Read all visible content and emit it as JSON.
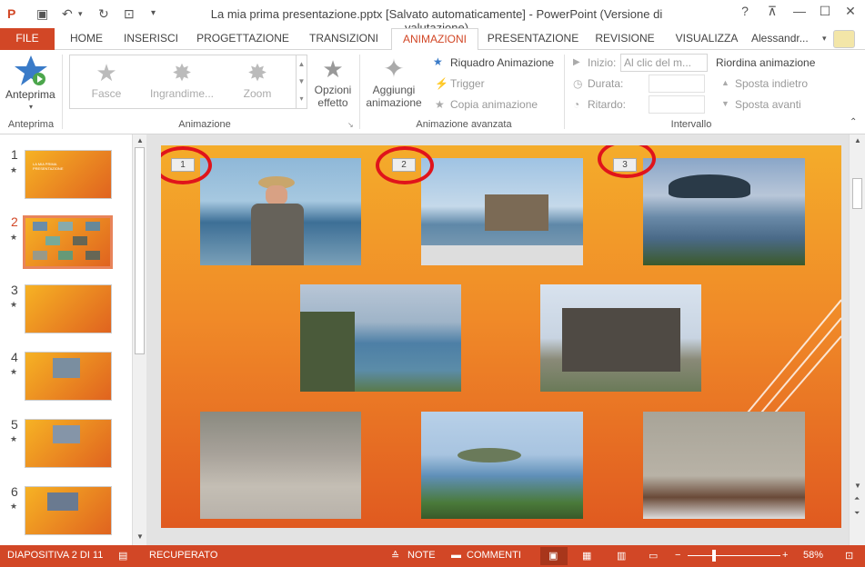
{
  "window": {
    "title": "La mia prima presentazione.pptx [Salvato automaticamente] - PowerPoint (Versione di valutazione)",
    "help": "?",
    "user": "Alessandr..."
  },
  "tabs": [
    "FILE",
    "HOME",
    "INSERISCI",
    "PROGETTAZIONE",
    "TRANSIZIONI",
    "ANIMAZIONI",
    "PRESENTAZIONE",
    "REVISIONE",
    "VISUALIZZA"
  ],
  "active_tab": "ANIMAZIONI",
  "ribbon": {
    "preview": {
      "label": "Anteprima",
      "group": "Anteprima"
    },
    "animation_group": {
      "label": "Animazione",
      "effects": [
        "Fasce",
        "Ingrandime...",
        "Zoom"
      ],
      "options": [
        "Opzioni",
        "effetto"
      ]
    },
    "advanced": {
      "label": "Animazione avanzata",
      "add": [
        "Aggiungi",
        "animazione"
      ],
      "pane": "Riquadro Animazione",
      "trigger": "Trigger",
      "copy": "Copia animazione"
    },
    "timing": {
      "label": "Intervallo",
      "start_label": "Inizio:",
      "start_value": "Al clic del m...",
      "duration_label": "Durata:",
      "delay_label": "Ritardo:",
      "reorder": "Riordina animazione",
      "move_back": "Sposta indietro",
      "move_forward": "Sposta avanti"
    }
  },
  "thumbnails": [
    {
      "num": "1",
      "caption": "LA MIA PRIMA PRESENTAZIONE"
    },
    {
      "num": "2",
      "caption": ""
    },
    {
      "num": "3",
      "caption": ""
    },
    {
      "num": "4",
      "caption": ""
    },
    {
      "num": "5",
      "caption": ""
    },
    {
      "num": "6",
      "caption": ""
    }
  ],
  "slide": {
    "tags": [
      "1",
      "2",
      "3"
    ]
  },
  "status": {
    "slide": "DIAPOSITIVA 2 DI 11",
    "recovered": "RECUPERATO",
    "notes": "NOTE",
    "comments": "COMMENTI",
    "zoom": "58%"
  },
  "colors": {
    "accent": "#d24726",
    "ring": "#e0141b"
  }
}
